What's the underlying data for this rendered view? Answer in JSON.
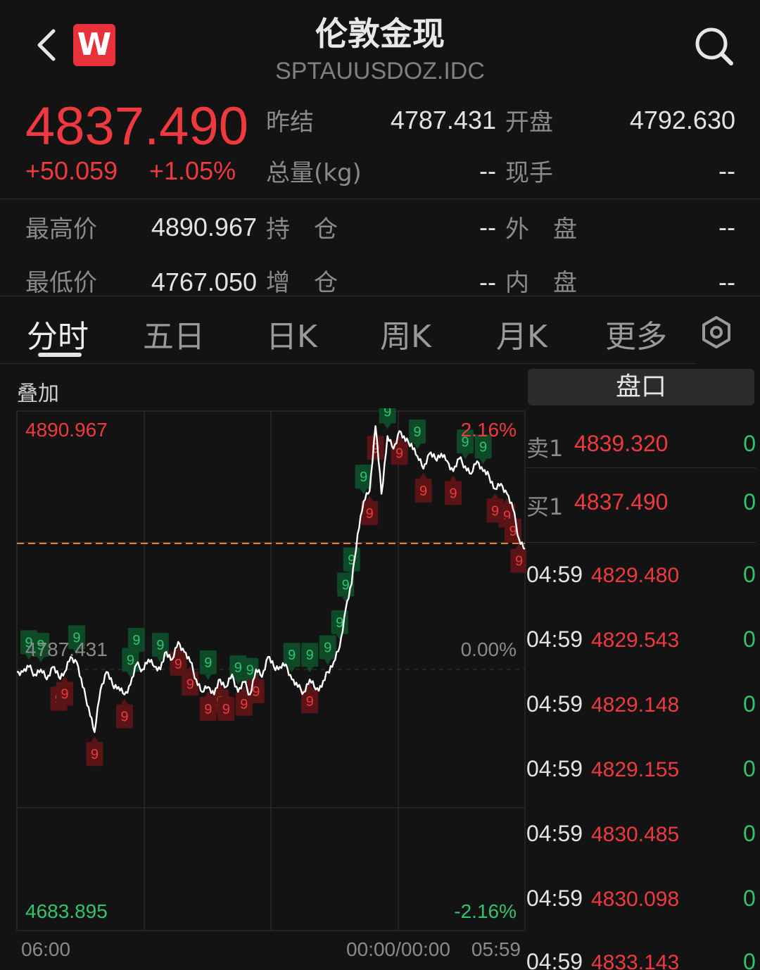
{
  "header": {
    "title": "伦敦金现",
    "code": "SPTAUUSDOZ.IDC",
    "logo_letter": "W"
  },
  "quote": {
    "price": "4837.490",
    "change": "+50.059",
    "change_pct": "+1.05%",
    "fields": [
      {
        "label": "昨结",
        "value": "4787.431"
      },
      {
        "label": "开盘",
        "value": "4792.630"
      },
      {
        "label": "总量(kg)",
        "value": "--"
      },
      {
        "label": "现手",
        "value": "--"
      },
      {
        "label": "最高价",
        "value": "4890.967"
      },
      {
        "label": "持　仓",
        "value": "--"
      },
      {
        "label": "外　盘",
        "value": "--"
      },
      {
        "label": "最低价",
        "value": "4767.050"
      },
      {
        "label": "增　仓",
        "value": "--"
      },
      {
        "label": "内　盘",
        "value": "--"
      }
    ]
  },
  "tabs": [
    "分时",
    "五日",
    "日K",
    "周K",
    "月K",
    "更多"
  ],
  "active_tab": "分时",
  "chart": {
    "overlay_label": "叠加",
    "y_high_label": "4890.967",
    "y_low_label": "4683.895",
    "pct_high_label": "2.16%",
    "pct_mid_label": "0.00%",
    "pct_low_label": "-2.16%",
    "baseline_label": "4787.431",
    "x_labels": [
      "06:00",
      "00:00/00:00",
      "05:59"
    ],
    "colors": {
      "up": "#2fc56d",
      "down": "#f0393e",
      "line": "#ffffff",
      "ref_line": "#e8832a"
    }
  },
  "chart_data": {
    "type": "line",
    "title": "",
    "xlabel": "",
    "ylabel": "",
    "ylim": [
      4683.895,
      4890.967
    ],
    "reference": 4787.431,
    "x": [
      "06:00",
      "00:00/00:00",
      "05:59"
    ],
    "series": [
      {
        "values": [
          4787,
          4787,
          4789,
          4786,
          4788,
          4784,
          4789,
          4785,
          4787,
          4793,
          4791,
          4781,
          4773,
          4763,
          4780,
          4787,
          4782,
          4781,
          4778,
          4782,
          4790,
          4788,
          4792,
          4789,
          4788,
          4795,
          4792,
          4799,
          4795,
          4791,
          4784,
          4779,
          4781,
          4778,
          4784,
          4781,
          4786,
          4779,
          4783,
          4778,
          4788,
          4785,
          4793,
          4789,
          4789,
          4790,
          4784,
          4781,
          4779,
          4784,
          4780,
          4781,
          4787,
          4791,
          4797,
          4812,
          4822,
          4842,
          4855,
          4859,
          4885,
          4858,
          4881,
          4876,
          4883,
          4879,
          4878,
          4873,
          4868,
          4874,
          4872,
          4874,
          4871,
          4867,
          4872,
          4869,
          4866,
          4871,
          4867,
          4865,
          4860,
          4862,
          4858,
          4852,
          4840,
          4836
        ]
      }
    ]
  },
  "orderbook": {
    "title": "盘口",
    "sell": {
      "label": "卖1",
      "price": "4839.320",
      "qty": "0"
    },
    "buy": {
      "label": "买1",
      "price": "4837.490",
      "qty": "0"
    },
    "ticks": [
      {
        "time": "04:59",
        "price": "4829.480",
        "qty": "0"
      },
      {
        "time": "04:59",
        "price": "4829.543",
        "qty": "0"
      },
      {
        "time": "04:59",
        "price": "4829.148",
        "qty": "0"
      },
      {
        "time": "04:59",
        "price": "4829.155",
        "qty": "0"
      },
      {
        "time": "04:59",
        "price": "4830.485",
        "qty": "0"
      },
      {
        "time": "04:59",
        "price": "4830.098",
        "qty": "0"
      },
      {
        "time": "04:59",
        "price": "4833.143",
        "qty": "0"
      }
    ]
  }
}
